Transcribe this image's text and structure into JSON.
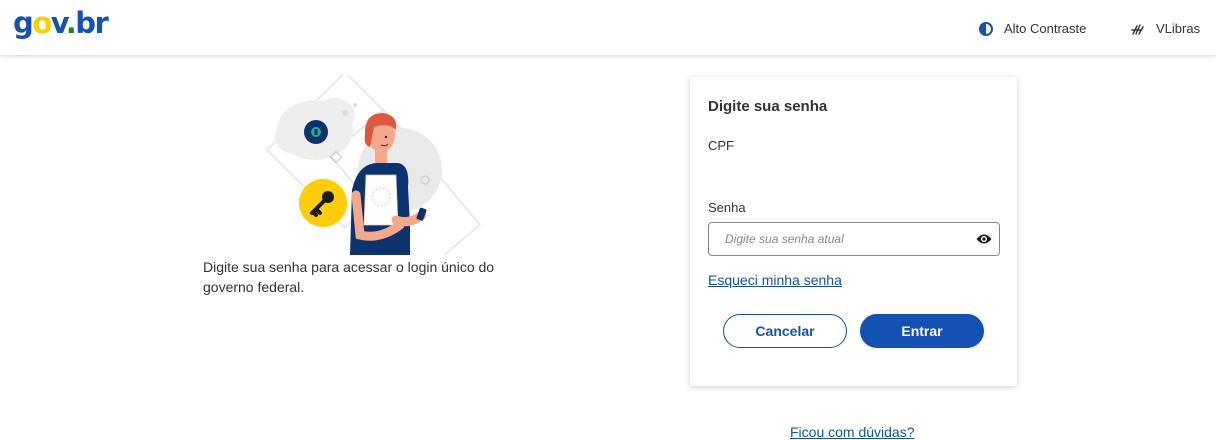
{
  "header": {
    "logo": {
      "g": "g",
      "o": "o",
      "v": "v",
      "dot": ".",
      "br": "br"
    },
    "contrast_label": "Alto Contraste",
    "vlibras_label": "VLibras",
    "icons": {
      "contrast": "contrast-icon",
      "vlibras": "sign-language-icon"
    }
  },
  "intro": {
    "text": "Digite sua senha para acessar o login único do governo federal."
  },
  "card": {
    "title": "Digite sua senha",
    "cpf_label": "CPF",
    "password_label": "Senha",
    "password_placeholder": "Digite sua senha atual",
    "password_value": "",
    "forgot_link": "Esqueci minha senha",
    "cancel_button": "Cancelar",
    "enter_button": "Entrar"
  },
  "help_link": "Ficou com dúvidas?",
  "colors": {
    "primary": "#1351b4",
    "logo_yellow": "#ffcd07",
    "logo_green": "#168821",
    "text": "#333333"
  }
}
